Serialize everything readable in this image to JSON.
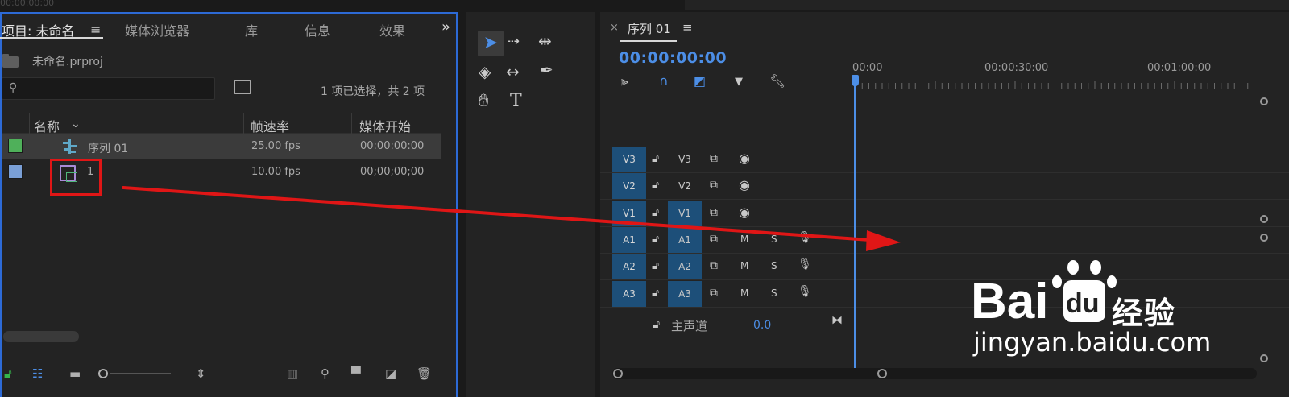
{
  "top": {
    "timecode": "00:00:00:00"
  },
  "project_panel": {
    "tabs": [
      "项目: 未命名",
      "媒体浏览器",
      "库",
      "信息",
      "效果"
    ],
    "menu_icon": "≡",
    "more_icon": "»",
    "project_file": "未命名.prproj",
    "search_placeholder": "",
    "selection_status": "1 项已选择，共 2 项",
    "columns": [
      "名称",
      "帧速率",
      "媒体开始"
    ],
    "items": [
      {
        "name": "序列 01",
        "fps": "25.00 fps",
        "start": "00:00:00:00",
        "color": "#4fb05a",
        "icon": "sequence-icon",
        "selected": true
      },
      {
        "name": "1",
        "fps": "10.00 fps",
        "start": "00;00;00;00",
        "color": "#7a9fd6",
        "icon": "image-sequence-icon",
        "selected": false
      }
    ]
  },
  "timeline": {
    "tab_title": "序列 01",
    "close_icon": "×",
    "menu_icon": "≡",
    "playhead_timecode": "00:00:00:00",
    "ruler_labels": [
      "00:00",
      "00:00:30:00",
      "00:01:00:00"
    ],
    "video_tracks": [
      {
        "name": "V3",
        "source": "V3",
        "source_on": false
      },
      {
        "name": "V2",
        "source": "V2",
        "source_on": false
      },
      {
        "name": "V1",
        "source": "V1",
        "source_on": true
      }
    ],
    "audio_tracks": [
      {
        "name": "A1",
        "source": "A1",
        "mute": "M",
        "solo": "S"
      },
      {
        "name": "A2",
        "source": "A2",
        "mute": "M",
        "solo": "S"
      },
      {
        "name": "A3",
        "source": "A3",
        "mute": "M",
        "solo": "S"
      }
    ],
    "master": {
      "label": "主声道",
      "value": "0.0"
    }
  },
  "watermark": {
    "brand": "经验",
    "url": "jingyan.baidu.com"
  },
  "colors": {
    "accent": "#4c8ee6",
    "track_blue": "#1d4f79",
    "annotation_red": "#e01616",
    "panel_focus": "#2d6ad6"
  }
}
